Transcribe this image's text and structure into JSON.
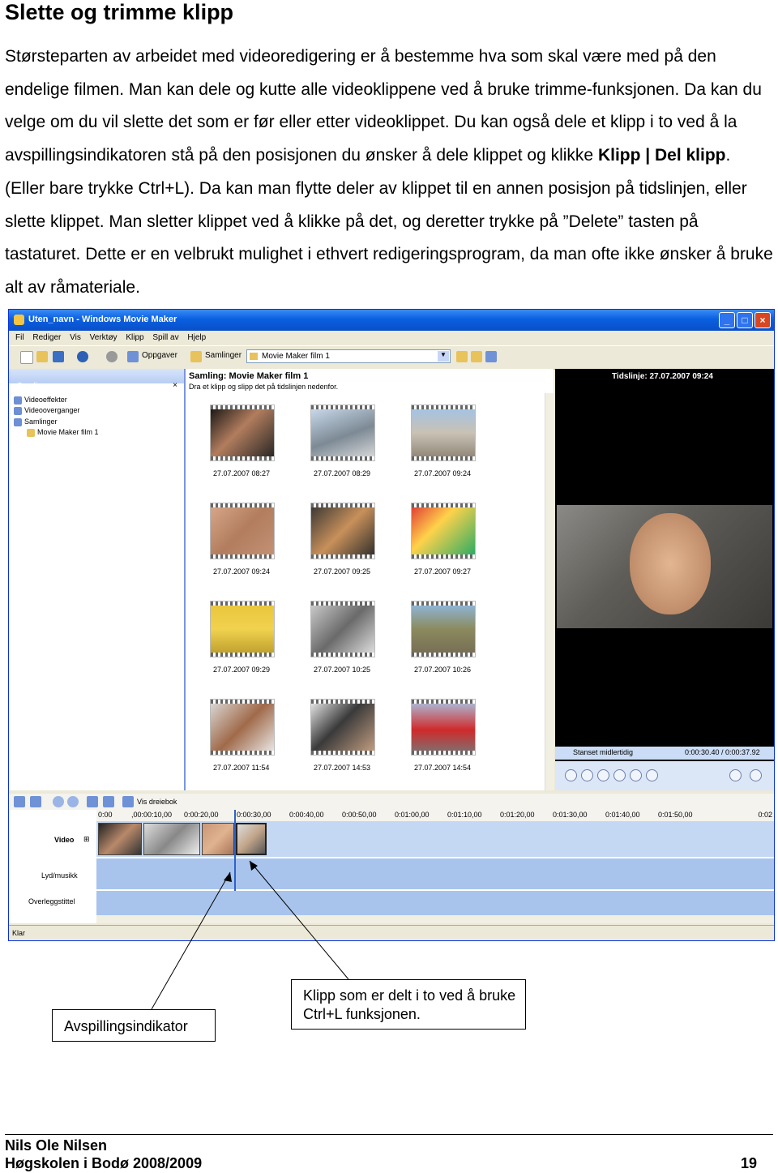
{
  "heading": "Slette og trimme klipp",
  "paragraph": {
    "part1": "Størsteparten av arbeidet med videoredigering er å bestemme hva som skal være med på den endelige filmen. Man kan dele og kutte alle videoklippene ved å bruke trimme-funksjonen. Da kan du velge om du vil slette det som er før eller etter videoklippet. Du kan også dele et klipp i to ved å la avspillingsindikatoren stå på den posisjonen du ønsker å dele klippet og klikke ",
    "bold1": "Klipp",
    "sep": " | ",
    "bold2": "Del klipp",
    "part2": ". (Eller bare trykke Ctrl+L). Da kan man flytte deler av klippet til en annen posisjon på tidslinjen, eller slette klippet. Man sletter klippet ved å klikke på det, og deretter trykke på ”Delete” tasten på tastaturet. Dette er en velbrukt mulighet i ethvert redigeringsprogram, da man ofte ikke ønsker å bruke alt av råmateriale."
  },
  "window": {
    "title": "Uten_navn - Windows Movie Maker",
    "controls": {
      "minimize": "_",
      "maximize": "□",
      "close": "×"
    },
    "menu": [
      "Fil",
      "Rediger",
      "Vis",
      "Verktøy",
      "Klipp",
      "Spill av",
      "Hjelp"
    ],
    "toolbar": {
      "tasks": "Oppgaver",
      "collections": "Samlinger",
      "collection_select": "Movie Maker film 1"
    },
    "left_pane": {
      "title": "Samlinger",
      "close": "×",
      "tree": [
        "Videoeffekter",
        "Videooverganger",
        "Samlinger",
        "Movie Maker film 1"
      ]
    },
    "collection": {
      "title": "Samling: Movie Maker film 1",
      "subtitle": "Dra et klipp og slipp det på tidslinjen nedenfor.",
      "clips": [
        "27.07.2007 08:27",
        "27.07.2007 08:29",
        "27.07.2007 09:24",
        "27.07.2007 09:24",
        "27.07.2007 09:25",
        "27.07.2007 09:27",
        "27.07.2007 09:29",
        "27.07.2007 10:25",
        "27.07.2007 10:26",
        "27.07.2007 11:54",
        "27.07.2007 14:53",
        "27.07.2007 14:54"
      ]
    },
    "preview": {
      "label": "Tidslinje: 27.07.2007 09:24",
      "status": "Stanset midlertidig",
      "time": "0:00:30.40 / 0:00:37.92"
    },
    "timeline": {
      "show_storyboard": "Vis dreiebok",
      "ruler": [
        "0:00",
        ",00:00:10,00",
        "0:00:20,00",
        "0:00:30,00",
        "0:00:40,00",
        "0:00:50,00",
        "0:01:00,00",
        "0:01:10,00",
        "0:01:20,00",
        "0:01:30,00",
        "0:01:40,00",
        "0:01:50,00",
        "0:02"
      ],
      "tracks": {
        "video": "Video",
        "audio": "Lyd/musikk",
        "overlay": "Overleggstittel"
      }
    },
    "statusbar": "Klar"
  },
  "callouts": {
    "indicator": "Avspillingsindikator",
    "split_clip": "Klipp som er delt i to ved å bruke Ctrl+L funksjonen."
  },
  "footer": {
    "author": "Nils Ole Nilsen",
    "school": "Høgskolen i Bodø 2008/2009",
    "page": "19"
  }
}
